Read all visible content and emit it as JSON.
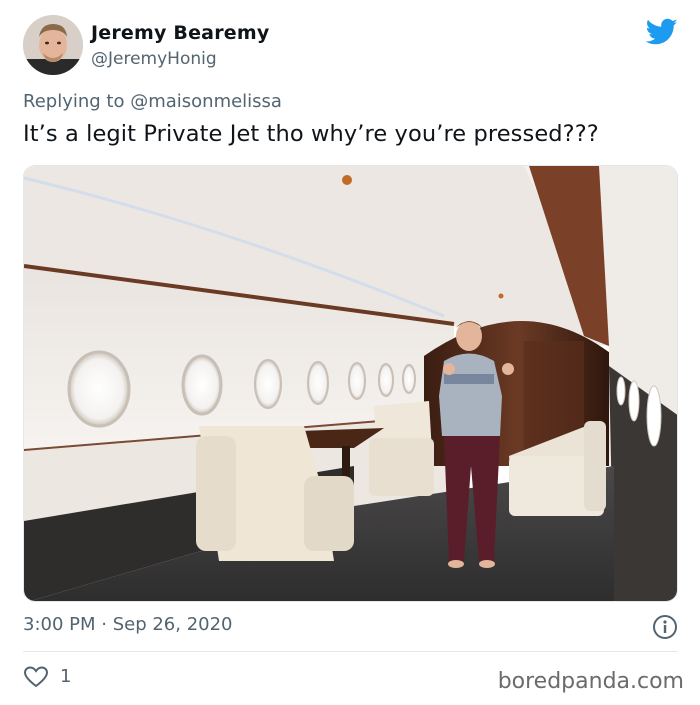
{
  "tweet": {
    "author_name": "Jeremy Bearemy",
    "author_handle": "@JeremyHonig",
    "reply_prefix": "Replying to ",
    "reply_mention": "@maisonmelissa",
    "text": "It’s a legit Private Jet tho why’re you’re pressed???",
    "timestamp": "3:00 PM · Sep 26, 2020",
    "like_count": "1"
  },
  "icons": {
    "brand": "twitter-bird-icon",
    "info": "info-icon",
    "like": "heart-icon"
  },
  "colors": {
    "twitter_blue": "#1d9bf0",
    "secondary_text": "#536471",
    "primary_text": "#0f1419"
  },
  "watermark": "boredpanda.com"
}
